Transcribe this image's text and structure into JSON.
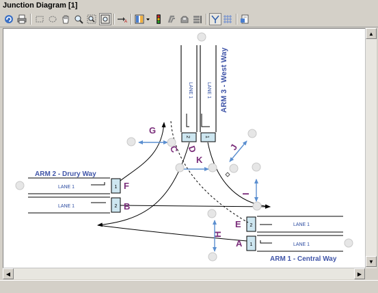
{
  "window": {
    "title": "Junction Diagram [1]"
  },
  "toolbar": {
    "icons": [
      "undo-icon",
      "print-icon",
      "rect-select-icon",
      "lasso-select-icon",
      "pan-hand-icon",
      "zoom-icon",
      "zoom-window-icon",
      "zoom-fit-icon",
      "arrow-a-icon",
      "lane-layout-icon",
      "dropdown-icon",
      "traffic-light-icon",
      "junction-pedestrian-icon",
      "vehicle-icon",
      "lane-icon",
      "flow-icon",
      "grid-icon",
      "report-icon"
    ]
  },
  "diagram": {
    "arms": {
      "arm1": "ARM 1 - Central Way",
      "arm2": "ARM 2 - Drury Way",
      "arm3": "ARM 3 - West Way"
    },
    "lane_label": "LANE 1",
    "lane_numbers": {
      "one": "1",
      "two": "2"
    },
    "flow_letters": {
      "A": "A",
      "B": "B",
      "C": "C",
      "D": "D",
      "E": "E",
      "F": "F",
      "G": "G",
      "H": "H",
      "I": "I",
      "J": "J",
      "K": "K"
    },
    "colors": {
      "arm_title": "#4055a8",
      "flow_letter": "#7a2d7a",
      "arrow": "#5b8fd0",
      "lane_box": "#cde6f0"
    }
  }
}
